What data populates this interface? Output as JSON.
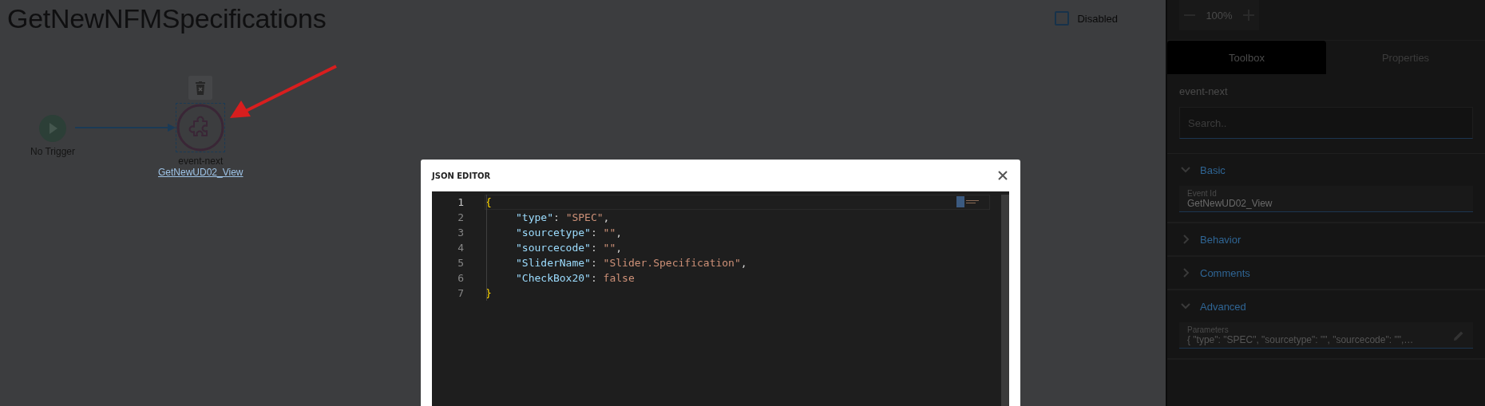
{
  "canvas": {
    "title": "GetNewNFMSpecifications",
    "disabled_checkbox": {
      "label": "Disabled",
      "checked": false
    },
    "nodes": [
      {
        "kind": "trigger",
        "label": "No Trigger"
      },
      {
        "kind": "event",
        "label": "event-next",
        "link": "GetNewUD02_View",
        "selected": true
      }
    ]
  },
  "zoom": {
    "value": "100%"
  },
  "tabs": [
    {
      "label": "Toolbox",
      "selected": true
    },
    {
      "label": "Properties",
      "selected": false
    }
  ],
  "panel": {
    "heading": "event-next",
    "search": {
      "placeholder": "Search.."
    },
    "sections": [
      {
        "title": "Basic",
        "expanded": true,
        "fields": [
          {
            "label": "Event Id",
            "value": "GetNewUD02_View",
            "kind": "text"
          }
        ]
      },
      {
        "title": "Behavior",
        "expanded": false
      },
      {
        "title": "Comments",
        "expanded": false
      },
      {
        "title": "Advanced",
        "expanded": true,
        "fields": [
          {
            "label": "Parameters",
            "value": "{ \"type\": \"SPEC\", \"sourcetype\": \"\", \"sourcecode\": \"\",…",
            "kind": "editable"
          }
        ]
      }
    ]
  },
  "dialog": {
    "title": "JSON EDITOR",
    "lines": [
      {
        "number": "1",
        "current": true,
        "tokens": [
          {
            "kind": "bracket",
            "text": "{"
          }
        ],
        "children": [
          {
            "number": "2",
            "current": false,
            "tokens": [
              {
                "kind": "key",
                "text": "\"type\""
              },
              {
                "kind": "punct",
                "text": ": "
              },
              {
                "kind": "string",
                "text": "\"SPEC\""
              },
              {
                "kind": "punct",
                "text": ","
              }
            ]
          },
          {
            "number": "3",
            "current": false,
            "tokens": [
              {
                "kind": "key",
                "text": "\"sourcetype\""
              },
              {
                "kind": "punct",
                "text": ": "
              },
              {
                "kind": "string",
                "text": "\"\""
              },
              {
                "kind": "punct",
                "text": ","
              }
            ]
          },
          {
            "number": "4",
            "current": false,
            "tokens": [
              {
                "kind": "key",
                "text": "\"sourcecode\""
              },
              {
                "kind": "punct",
                "text": ": "
              },
              {
                "kind": "string",
                "text": "\"\""
              },
              {
                "kind": "punct",
                "text": ","
              }
            ]
          },
          {
            "number": "5",
            "current": false,
            "tokens": [
              {
                "kind": "key",
                "text": "\"SliderName\""
              },
              {
                "kind": "punct",
                "text": ": "
              },
              {
                "kind": "string",
                "text": "\"Slider.Specification\""
              },
              {
                "kind": "punct",
                "text": ","
              }
            ]
          },
          {
            "number": "6",
            "current": false,
            "tokens": [
              {
                "kind": "key",
                "text": "\"CheckBox20\""
              },
              {
                "kind": "punct",
                "text": ": "
              },
              {
                "kind": "bool",
                "text": "false"
              }
            ]
          }
        ]
      },
      {
        "number": "7",
        "current": false,
        "tokens": [
          {
            "kind": "bracket",
            "text": "}"
          }
        ]
      }
    ]
  }
}
